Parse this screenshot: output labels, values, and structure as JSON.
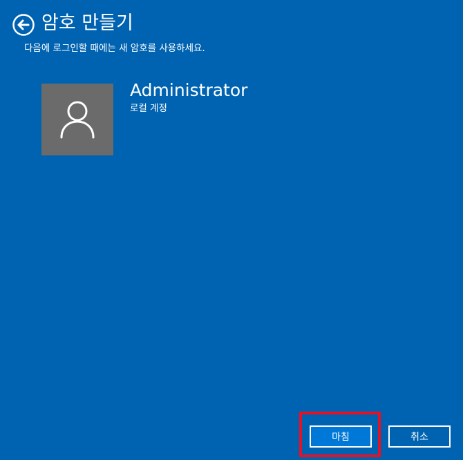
{
  "header": {
    "back_icon": "back-arrow-icon",
    "title": "암호 만들기",
    "subtitle": "다음에 로그인할 때에는 새 암호를 사용하세요."
  },
  "account": {
    "avatar_icon": "user-icon",
    "name": "Administrator",
    "type": "로컬 계정"
  },
  "footer": {
    "finish_label": "마침",
    "cancel_label": "취소"
  },
  "colors": {
    "background": "#0063b1",
    "finish_button": "#0078d7",
    "avatar_background": "#6b6b6b",
    "highlight": "#e81123",
    "text": "#ffffff"
  }
}
